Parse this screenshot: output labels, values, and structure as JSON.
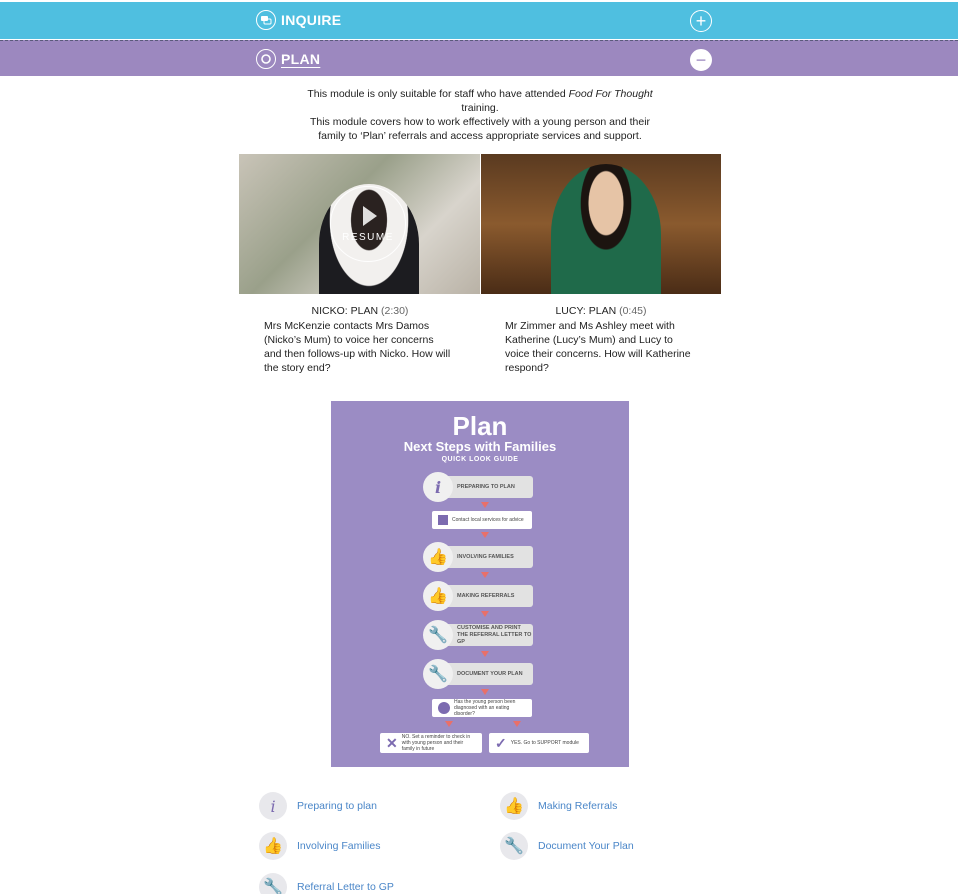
{
  "sections": {
    "inquire": {
      "label": "INQUIRE",
      "toggle": "+"
    },
    "plan": {
      "label": "PLAN",
      "toggle": "−"
    }
  },
  "intro": {
    "line1_pre": "This module is only suitable for staff who have attended",
    "line1_em": "Food For Thought",
    "line1_post": "training.",
    "line2": "This module covers how to work effectively with a young person and their family to ‘Plan’ referrals and access appropriate services and support."
  },
  "videos": [
    {
      "title": "NICKO: PLAN",
      "duration": "(2:30)",
      "overlay": "RESUME",
      "description": "Mrs McKenzie contacts Mrs Damos (Nicko’s Mum) to voice her concerns and then follows-up with Nicko. How will the story end?"
    },
    {
      "title": "LUCY: PLAN",
      "duration": "(0:45)",
      "description": "Mr Zimmer and Ms Ashley meet with Katherine (Lucy’s Mum) and Lucy to voice their concerns. How will Katherine respond?"
    }
  ],
  "poster": {
    "title": "Plan",
    "subtitle": "Next Steps with Families",
    "guide": "QUICK LOOK GUIDE",
    "steps": {
      "preparing": "PREPARING TO PLAN",
      "contact": "Contact local services for advice",
      "involving": "INVOLVING FAMILIES",
      "referrals": "MAKING REFERRALS",
      "customise": "CUSTOMISE AND PRINT THE REFERRAL LETTER TO GP",
      "document": "DOCUMENT YOUR PLAN",
      "question": "Has the young person been diagnosed with an eating disorder?",
      "no": "NO. Set a reminder to check in with young person and their family in future",
      "yes": "YES. Go to SUPPORT module"
    }
  },
  "links": [
    {
      "label": "Preparing to plan",
      "icon": "info-icon"
    },
    {
      "label": "Making Referrals",
      "icon": "thumbs-up-icon"
    },
    {
      "label": "Involving Families",
      "icon": "thumbs-up-icon"
    },
    {
      "label": "Document Your Plan",
      "icon": "wrench-icon"
    },
    {
      "label": "Referral Letter to GP",
      "icon": "wrench-icon"
    }
  ],
  "colors": {
    "inquire_bar": "#4fbfe0",
    "plan_bar": "#9c88bf",
    "link": "#4a86c8",
    "poster_bg": "#9b8cc4"
  }
}
